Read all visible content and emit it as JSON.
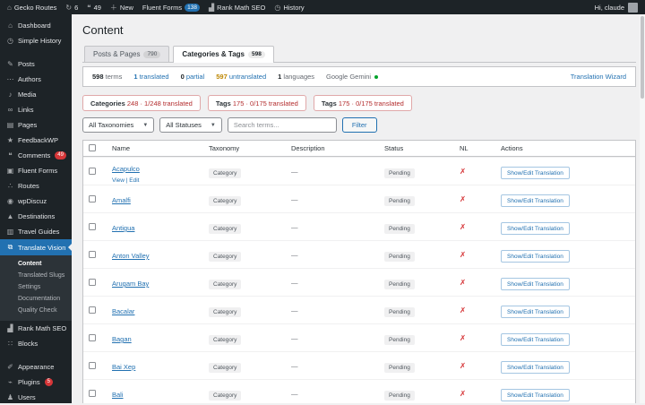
{
  "colors": {
    "accent": "#2271b1",
    "danger": "#d63638",
    "warning": "#bd8600",
    "success": "#00a32a",
    "sidebar_bg": "#1d2327"
  },
  "admin_bar": {
    "site": "Gecko Routes",
    "updates": "6",
    "comments": "49",
    "new_label": "New",
    "fluent_forms_label": "Fluent Forms",
    "fluent_forms_badge": "138",
    "rank_math_label": "Rank Math SEO",
    "history_label": "History",
    "greeting": "Hi, claude"
  },
  "sidebar": {
    "group1": [
      {
        "icon": "dashboard-icon",
        "glyph": "⌂",
        "label": "Dashboard",
        "badge": ""
      },
      {
        "icon": "clock-icon",
        "glyph": "◷",
        "label": "Simple History",
        "badge": ""
      }
    ],
    "group2": [
      {
        "icon": "pin-icon",
        "glyph": "✎",
        "label": "Posts",
        "badge": ""
      },
      {
        "icon": "ellipsis-icon",
        "glyph": "⋯",
        "label": "Authors",
        "badge": ""
      },
      {
        "icon": "media-icon",
        "glyph": "♪",
        "label": "Media",
        "badge": ""
      },
      {
        "icon": "link-icon",
        "glyph": "∞",
        "label": "Links",
        "badge": ""
      },
      {
        "icon": "pages-icon",
        "glyph": "▤",
        "label": "Pages",
        "badge": ""
      },
      {
        "icon": "thumb-icon",
        "glyph": "★",
        "label": "FeedbackWP",
        "badge": ""
      },
      {
        "icon": "comments-bubble-icon",
        "glyph": "❝",
        "label": "Comments",
        "badge": "49"
      },
      {
        "icon": "form-icon",
        "glyph": "▣",
        "label": "Fluent Forms",
        "badge": ""
      },
      {
        "icon": "network-icon",
        "glyph": "∴",
        "label": "Routes",
        "badge": ""
      },
      {
        "icon": "discuz-icon",
        "glyph": "◉",
        "label": "wpDiscuz",
        "badge": ""
      },
      {
        "icon": "mountain-icon",
        "glyph": "▲",
        "label": "Destinations",
        "badge": ""
      },
      {
        "icon": "book-icon",
        "glyph": "▥",
        "label": "Travel Guides",
        "badge": ""
      }
    ],
    "active_item": {
      "icon": "translate-icon",
      "glyph": "⧉",
      "label": "Translate Vision"
    },
    "submenu_active": "Content",
    "submenu_items": [
      {
        "label": "Translated Slugs"
      },
      {
        "label": "Settings"
      },
      {
        "label": "Documentation"
      },
      {
        "label": "Quality Check"
      }
    ],
    "group3": [
      {
        "icon": "chart-icon",
        "glyph": "▟",
        "label": "Rank Math SEO",
        "badge": ""
      },
      {
        "icon": "blocks-icon",
        "glyph": "∷",
        "label": "Blocks",
        "badge": ""
      }
    ],
    "group4": [
      {
        "icon": "brush-icon",
        "glyph": "✐",
        "label": "Appearance",
        "badge": ""
      },
      {
        "icon": "plugin-icon",
        "glyph": "⌁",
        "label": "Plugins",
        "badge": "5"
      },
      {
        "icon": "user-icon",
        "glyph": "♟",
        "label": "Users",
        "badge": ""
      }
    ]
  },
  "page": {
    "title": "Content"
  },
  "tabs": {
    "posts": {
      "label": "Posts & Pages",
      "count": "790"
    },
    "categories": {
      "label": "Categories & Tags",
      "count": "598"
    }
  },
  "stats": {
    "terms": {
      "value": "598",
      "label": "terms"
    },
    "translated": {
      "value": "1",
      "label": "translated"
    },
    "partial": {
      "value": "0",
      "label": "partial"
    },
    "untranslated": {
      "value": "597",
      "label": "untranslated"
    },
    "languages": {
      "value": "1",
      "label": "languages"
    },
    "engine": {
      "label": "Google Gemini"
    },
    "wizard": "Translation Wizard"
  },
  "summary_pills": [
    {
      "label": "Categories",
      "detail": "248 · 1/248 translated"
    },
    {
      "label": "Tags",
      "detail": "175 · 0/175 translated"
    },
    {
      "label": "Tags",
      "detail": "175 · 0/175 translated"
    }
  ],
  "filter_bar": {
    "taxonomy_select": "All Taxonomies",
    "status_select": "All Statuses",
    "search_placeholder": "Search terms...",
    "filter_button": "Filter"
  },
  "table": {
    "columns": [
      "Name",
      "Taxonomy",
      "Description",
      "Status",
      "NL",
      "Actions"
    ],
    "rows": [
      {
        "name": "Acapulco",
        "links": "View | Edit",
        "taxonomy": "Category",
        "description": "—",
        "status": "Pending",
        "nl": "✗",
        "action": "Show/Edit Translation"
      },
      {
        "name": "Amalfi",
        "links": "",
        "taxonomy": "Category",
        "description": "—",
        "status": "Pending",
        "nl": "✗",
        "action": "Show/Edit Translation"
      },
      {
        "name": "Antigua",
        "links": "",
        "taxonomy": "Category",
        "description": "—",
        "status": "Pending",
        "nl": "✗",
        "action": "Show/Edit Translation"
      },
      {
        "name": "Anton Valley",
        "links": "",
        "taxonomy": "Category",
        "description": "—",
        "status": "Pending",
        "nl": "✗",
        "action": "Show/Edit Translation"
      },
      {
        "name": "Arugam Bay",
        "links": "",
        "taxonomy": "Category",
        "description": "—",
        "status": "Pending",
        "nl": "✗",
        "action": "Show/Edit Translation"
      },
      {
        "name": "Bacalar",
        "links": "",
        "taxonomy": "Category",
        "description": "—",
        "status": "Pending",
        "nl": "✗",
        "action": "Show/Edit Translation"
      },
      {
        "name": "Bagan",
        "links": "",
        "taxonomy": "Category",
        "description": "—",
        "status": "Pending",
        "nl": "✗",
        "action": "Show/Edit Translation"
      },
      {
        "name": "Bai Xep",
        "links": "",
        "taxonomy": "Category",
        "description": "—",
        "status": "Pending",
        "nl": "✗",
        "action": "Show/Edit Translation"
      },
      {
        "name": "Bali",
        "links": "",
        "taxonomy": "Category",
        "description": "—",
        "status": "Pending",
        "nl": "✗",
        "action": "Show/Edit Translation"
      }
    ]
  }
}
